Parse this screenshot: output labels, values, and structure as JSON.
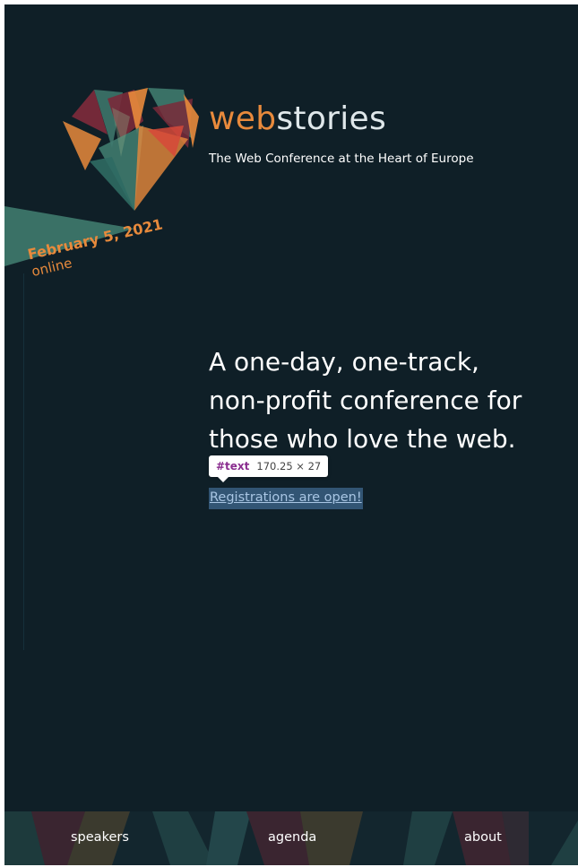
{
  "brand": {
    "name_part1": "web",
    "name_part2": "stories",
    "tagline": "The Web Conference at the Heart of Europe"
  },
  "event": {
    "date": "February 5, 2021",
    "mode": "online"
  },
  "hero": {
    "line1": "A one-day, one-track,",
    "line2": "non-profit conference for",
    "line3": "those who love the web.",
    "cta": "Registrations are open!"
  },
  "devtools_tooltip": {
    "tag": "#text",
    "size": "170.25 × 27"
  },
  "nav": {
    "items": [
      {
        "label": "speakers"
      },
      {
        "label": "agenda"
      },
      {
        "label": "about"
      }
    ]
  },
  "colors": {
    "background": "#0f1f27",
    "accent_orange": "#e88a3c",
    "teal": "#3f7a6e",
    "crimson": "#7a2a3a",
    "link": "#a9c6e4"
  },
  "icons": {
    "logo": "geometric-heart-icon"
  }
}
